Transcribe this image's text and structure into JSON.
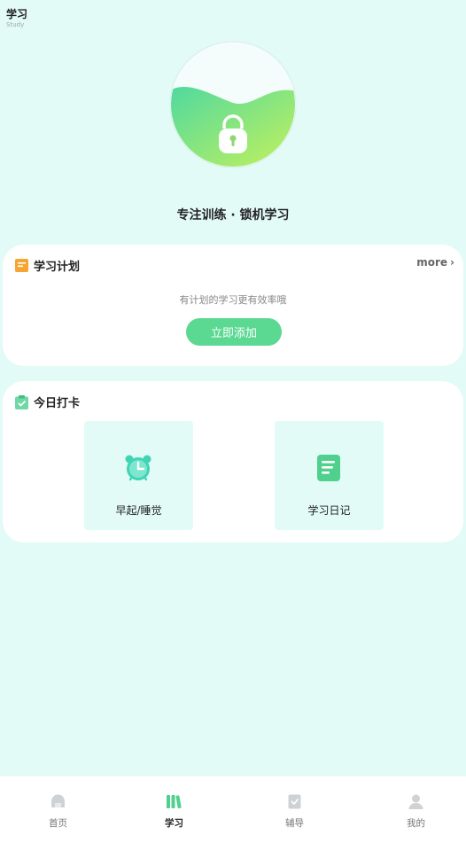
{
  "header": {
    "title": "学习",
    "subtitle": "Study"
  },
  "hero": {
    "slogan": "专注训练 · 锁机学习",
    "icon": "lock-icon"
  },
  "plan_card": {
    "title": "学习计划",
    "more_label": "more",
    "tip": "有计划的学习更有效率哦",
    "add_label": "立即添加",
    "icon": "notebook-icon"
  },
  "checkin_card": {
    "title": "今日打卡",
    "icon": "clipboard-check-icon",
    "tiles": [
      {
        "label": "早起/睡觉",
        "icon": "alarm-clock-icon"
      },
      {
        "label": "学习日记",
        "icon": "document-icon"
      }
    ]
  },
  "tabbar": {
    "items": [
      {
        "label": "首页",
        "icon": "home-icon"
      },
      {
        "label": "学习",
        "icon": "books-icon"
      },
      {
        "label": "辅导",
        "icon": "shield-icon"
      },
      {
        "label": "我的",
        "icon": "user-icon"
      }
    ]
  },
  "colors": {
    "accent": "#5bd892",
    "background": "#e2fbf7",
    "orange": "#f7a531"
  }
}
